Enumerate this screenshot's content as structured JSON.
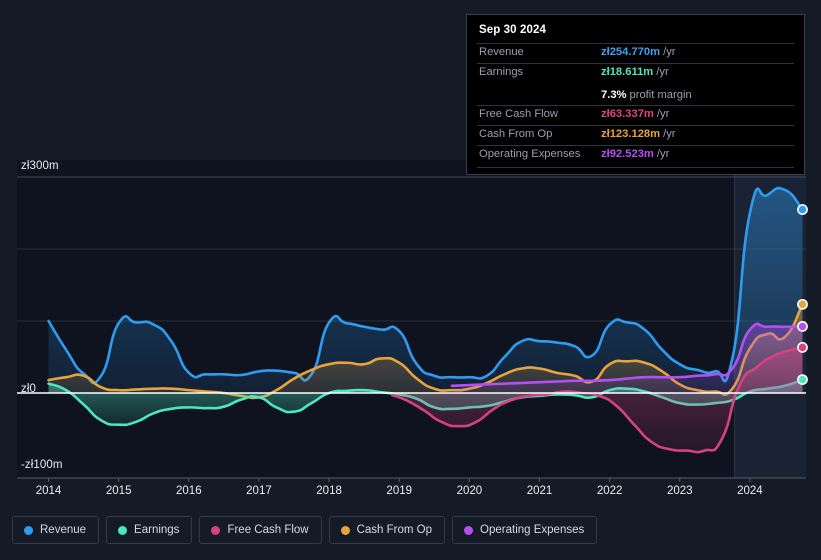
{
  "tooltip": {
    "title": "Sep 30 2024",
    "rows": [
      {
        "label": "Revenue",
        "value": "zł254.770m",
        "unit": "/yr",
        "color": "#3aa3f0"
      },
      {
        "label": "Earnings",
        "value": "zł18.611m",
        "unit": "/yr",
        "color": "#4de6c0"
      },
      {
        "label": "Free Cash Flow",
        "value": "zł63.337m",
        "unit": "/yr",
        "color": "#e0447e"
      },
      {
        "label": "Cash From Op",
        "value": "zł123.128m",
        "unit": "/yr",
        "color": "#e8a33d"
      },
      {
        "label": "Operating Expenses",
        "value": "zł92.523m",
        "unit": "/yr",
        "color": "#b44ff0"
      }
    ],
    "margin_value": "7.3%",
    "margin_text": "profit margin"
  },
  "legend": {
    "items": [
      {
        "label": "Revenue",
        "color": "#2e9cf0"
      },
      {
        "label": "Earnings",
        "color": "#4de6c0"
      },
      {
        "label": "Free Cash Flow",
        "color": "#d6427f"
      },
      {
        "label": "Cash From Op",
        "color": "#e8a33d"
      },
      {
        "label": "Operating Expenses",
        "color": "#b44ff0"
      }
    ]
  },
  "chart_data": {
    "type": "area",
    "title": "",
    "xlabel": "",
    "ylabel": "",
    "currency": "zł",
    "units": "m",
    "grid": true,
    "legend_position": "bottom",
    "ylim": [
      -100,
      300
    ],
    "y_ticks": [
      {
        "value": 300,
        "label": "zł300m"
      },
      {
        "value": 200,
        "label": ""
      },
      {
        "value": 100,
        "label": ""
      },
      {
        "value": 0,
        "label": "zł0"
      },
      {
        "value": -100,
        "label": "-zł100m"
      }
    ],
    "y_tick_labels_visible": [
      "zł300m",
      "zł0",
      "-zł100m"
    ],
    "xlim": [
      2013.55,
      2024.8
    ],
    "x_ticks": [
      2014,
      2015,
      2016,
      2017,
      2018,
      2019,
      2020,
      2021,
      2022,
      2023,
      2024
    ],
    "x_tick_labels": [
      "2014",
      "2015",
      "2016",
      "2017",
      "2018",
      "2019",
      "2020",
      "2021",
      "2022",
      "2023",
      "2024"
    ],
    "forecast_start": 2023.78,
    "series": [
      {
        "name": "Revenue",
        "color": "#2e9cf0",
        "x": [
          2014.0,
          2014.25,
          2014.5,
          2014.75,
          2015.0,
          2015.25,
          2015.5,
          2015.75,
          2016.0,
          2016.25,
          2016.5,
          2016.75,
          2017.0,
          2017.25,
          2017.5,
          2017.75,
          2018.0,
          2018.25,
          2018.5,
          2018.75,
          2019.0,
          2019.25,
          2019.5,
          2019.75,
          2020.0,
          2020.25,
          2020.5,
          2020.75,
          2021.0,
          2021.25,
          2021.5,
          2021.75,
          2022.0,
          2022.25,
          2022.5,
          2022.75,
          2023.0,
          2023.25,
          2023.5,
          2023.75,
          2024.0,
          2024.25,
          2024.5,
          2024.75
        ],
        "y": [
          100,
          60,
          27,
          24,
          97,
          98,
          95,
          72,
          28,
          26,
          26,
          25,
          30,
          31,
          28,
          26,
          98,
          97,
          92,
          88,
          86,
          40,
          24,
          22,
          22,
          24,
          50,
          72,
          72,
          70,
          65,
          52,
          95,
          98,
          88,
          60,
          40,
          32,
          30,
          48,
          250,
          275,
          282,
          254.77
        ]
      },
      {
        "name": "Earnings",
        "color": "#4de6c0",
        "x": [
          2014.0,
          2014.25,
          2014.5,
          2014.75,
          2015.0,
          2015.25,
          2015.5,
          2015.75,
          2016.0,
          2016.25,
          2016.5,
          2016.75,
          2017.0,
          2017.25,
          2017.5,
          2017.75,
          2018.0,
          2018.25,
          2018.5,
          2018.75,
          2019.0,
          2019.25,
          2019.5,
          2019.75,
          2020.0,
          2020.25,
          2020.5,
          2020.75,
          2021.0,
          2021.25,
          2021.5,
          2021.75,
          2022.0,
          2022.25,
          2022.5,
          2022.75,
          2023.0,
          2023.25,
          2023.5,
          2023.75,
          2024.0,
          2024.25,
          2024.5,
          2024.75
        ],
        "y": [
          13,
          4,
          -16,
          -38,
          -44,
          -40,
          -28,
          -22,
          -20,
          -21,
          -19,
          -9,
          -6,
          -20,
          -26,
          -14,
          0,
          3,
          4,
          1,
          -2,
          -8,
          -20,
          -22,
          -20,
          -18,
          -12,
          -6,
          -4,
          -2,
          -3,
          -6,
          4,
          6,
          2,
          -6,
          -14,
          -16,
          -14,
          -10,
          2,
          6,
          10,
          18.611
        ]
      },
      {
        "name": "Free Cash Flow",
        "color": "#d6427f",
        "x": [
          2018.9,
          2019.1,
          2019.35,
          2019.6,
          2019.85,
          2020.1,
          2020.35,
          2020.6,
          2020.85,
          2021.1,
          2021.35,
          2021.6,
          2021.85,
          2022.1,
          2022.35,
          2022.6,
          2022.85,
          2023.1,
          2023.35,
          2023.6,
          2023.85,
          2024.1,
          2024.35,
          2024.6,
          2024.75
        ],
        "y": [
          -3,
          -10,
          -24,
          -40,
          -46,
          -40,
          -22,
          -10,
          -4,
          -2,
          2,
          0,
          -4,
          -18,
          -44,
          -68,
          -78,
          -80,
          -80,
          -64,
          10,
          36,
          52,
          60,
          63.337
        ]
      },
      {
        "name": "Cash From Op",
        "color": "#e8a33d",
        "x": [
          2014.0,
          2014.25,
          2014.5,
          2014.75,
          2015.0,
          2015.25,
          2015.5,
          2015.75,
          2016.0,
          2016.25,
          2016.5,
          2016.75,
          2017.0,
          2017.25,
          2017.5,
          2017.75,
          2018.0,
          2018.25,
          2018.5,
          2018.75,
          2019.0,
          2019.25,
          2019.5,
          2019.75,
          2020.0,
          2020.25,
          2020.5,
          2020.75,
          2021.0,
          2021.25,
          2021.5,
          2021.75,
          2022.0,
          2022.25,
          2022.5,
          2022.75,
          2023.0,
          2023.25,
          2023.5,
          2023.75,
          2024.0,
          2024.25,
          2024.5,
          2024.75
        ],
        "y": [
          18,
          22,
          24,
          8,
          4,
          5,
          6,
          6,
          4,
          2,
          0,
          -4,
          -6,
          4,
          20,
          32,
          40,
          42,
          40,
          48,
          42,
          20,
          6,
          4,
          6,
          14,
          26,
          34,
          34,
          28,
          24,
          16,
          40,
          44,
          42,
          30,
          12,
          4,
          2,
          6,
          62,
          82,
          78,
          123.128
        ]
      },
      {
        "name": "Operating Expenses",
        "color": "#b44ff0",
        "x": [
          2019.75,
          2020.0,
          2020.25,
          2020.5,
          2020.75,
          2021.0,
          2021.25,
          2021.5,
          2021.75,
          2022.0,
          2022.25,
          2022.5,
          2022.75,
          2023.0,
          2023.25,
          2023.5,
          2023.75,
          2024.0,
          2024.25,
          2024.5,
          2024.75
        ],
        "y": [
          10,
          11,
          12,
          13,
          14,
          15,
          16,
          17,
          17,
          18,
          20,
          22,
          22,
          22,
          24,
          26,
          34,
          88,
          92,
          92,
          92.523
        ]
      }
    ]
  }
}
